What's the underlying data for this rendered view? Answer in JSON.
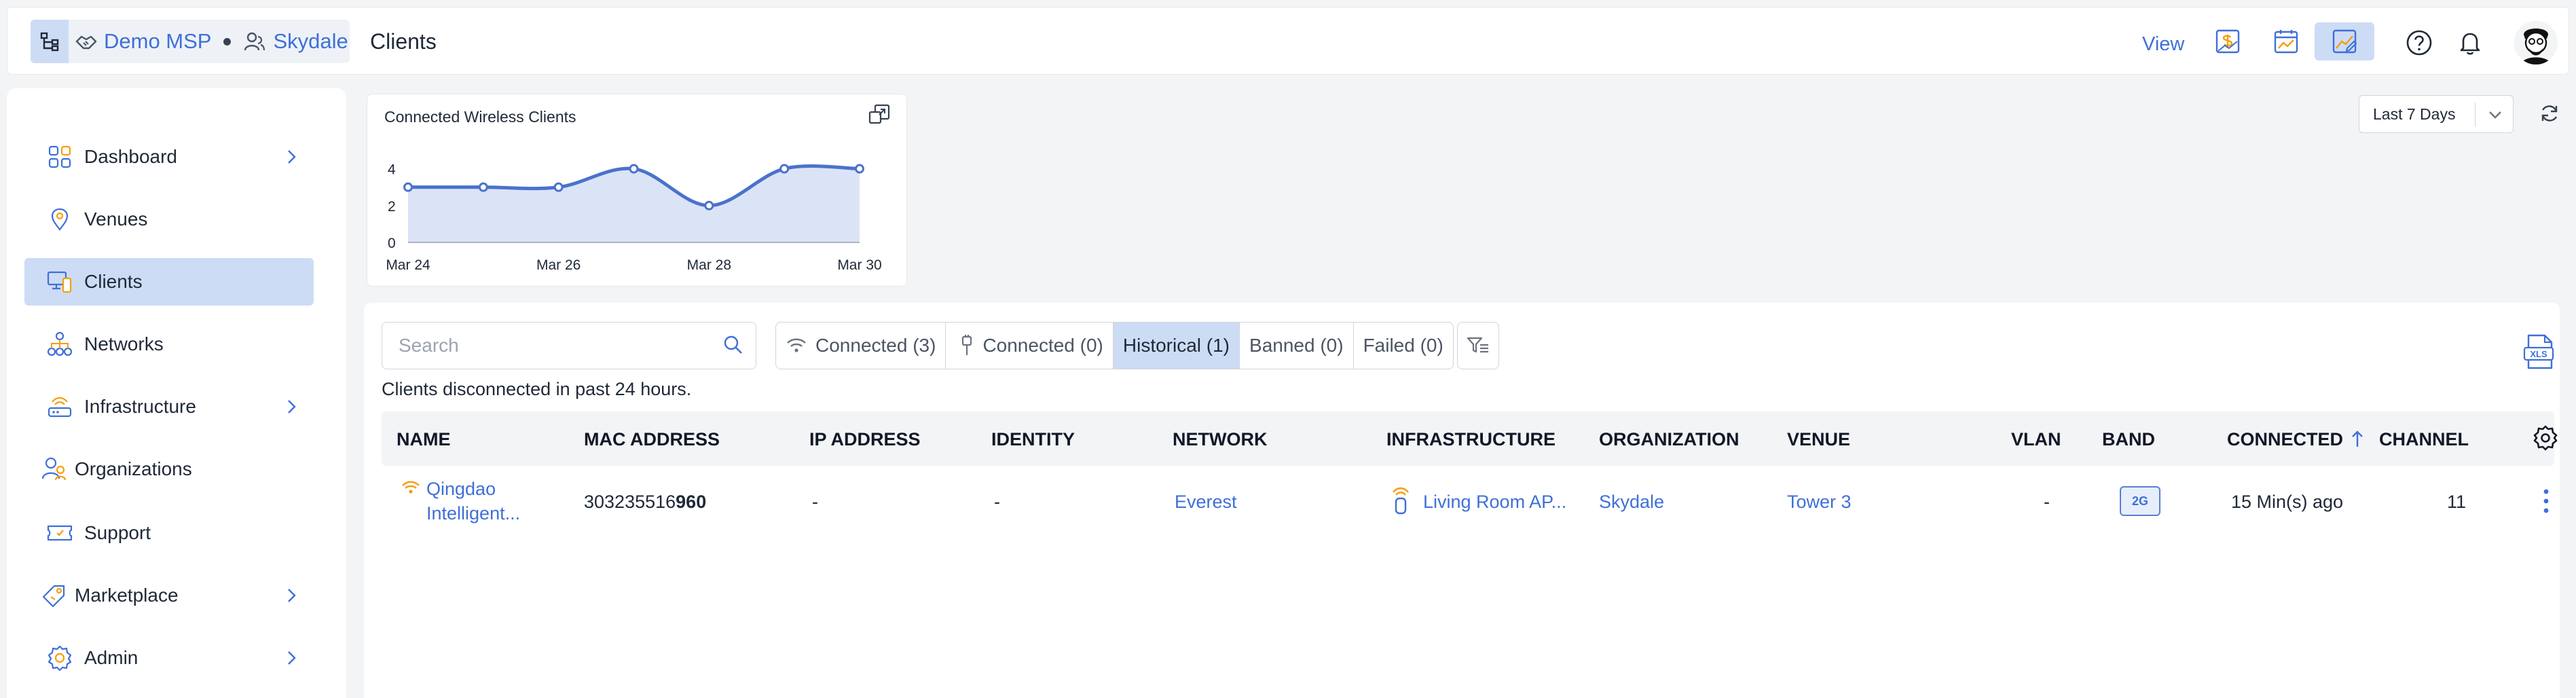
{
  "breadcrumb": {
    "org": "Demo MSP",
    "tenant": "Skydale"
  },
  "header": {
    "title": "Clients",
    "view_label": "View",
    "view_buttons": [
      "dollar-report-icon",
      "calendar-report-icon",
      "edit-report-icon"
    ],
    "icons": [
      "help-icon",
      "bell-icon",
      "user-avatar"
    ]
  },
  "sidebar": {
    "items": [
      {
        "label": "Dashboard",
        "icon": "dashboard-icon",
        "has_children": true
      },
      {
        "label": "Venues",
        "icon": "location-pin-icon",
        "has_children": false
      },
      {
        "label": "Clients",
        "icon": "devices-icon",
        "has_children": false,
        "active": true
      },
      {
        "label": "Networks",
        "icon": "network-icon",
        "has_children": false
      },
      {
        "label": "Infrastructure",
        "icon": "router-icon",
        "has_children": true
      },
      {
        "label": "Organizations",
        "icon": "organizations-icon",
        "has_children": false
      },
      {
        "label": "Support",
        "icon": "ticket-icon",
        "has_children": false
      },
      {
        "label": "Marketplace",
        "icon": "tag-icon",
        "has_children": true
      },
      {
        "label": "Admin",
        "icon": "gear-icon",
        "has_children": true
      }
    ]
  },
  "range_select": {
    "value": "Last 7 Days"
  },
  "chart_data": {
    "type": "area",
    "title": "Connected Wireless Clients",
    "x": [
      "Mar 24",
      "Mar 25",
      "Mar 26",
      "Mar 27",
      "Mar 28",
      "Mar 29",
      "Mar 30"
    ],
    "series": [
      {
        "values": [
          3,
          3,
          3,
          4,
          2,
          4,
          4
        ]
      }
    ],
    "x_tick_labels": [
      "Mar 24",
      "Mar 26",
      "Mar 28",
      "Mar 30"
    ],
    "y_ticks": [
      0,
      2,
      4
    ],
    "ylim": [
      0,
      4.5
    ],
    "grid": false,
    "colors": {
      "line": "#4a72cc",
      "fill": "#dbe3f7"
    }
  },
  "search": {
    "placeholder": "Search"
  },
  "filters": [
    {
      "label": "Connected (3)",
      "icon": "wifi-icon"
    },
    {
      "label": "Connected (0)",
      "icon": "wired-icon"
    },
    {
      "label": "Historical (1)",
      "active": true
    },
    {
      "label": "Banned (0)"
    },
    {
      "label": "Failed (0)"
    }
  ],
  "sub_note": "Clients disconnected in past 24 hours.",
  "table": {
    "columns": [
      "NAME",
      "MAC ADDRESS",
      "IP ADDRESS",
      "IDENTITY",
      "NETWORK",
      "INFRASTRUCTURE",
      "ORGANIZATION",
      "VENUE",
      "VLAN",
      "BAND",
      "CONNECTED",
      "CHANNEL"
    ],
    "sort_column": "CONNECTED",
    "rows": [
      {
        "name_line1": "Qingdao",
        "name_line2": "Intelligent...",
        "mac_prefix": "303235516",
        "mac_suffix": "960",
        "ip": "-",
        "identity": "-",
        "network": "Everest",
        "infrastructure": "Living Room AP...",
        "organization": "Skydale",
        "venue": "Tower 3",
        "vlan": "-",
        "band": "2G",
        "connected": "15 Min(s) ago",
        "channel": "11"
      }
    ]
  },
  "colors": {
    "accent": "#3f6fd8",
    "active_bg": "#cddcf5",
    "wifi_orange": "#f59e0b"
  }
}
